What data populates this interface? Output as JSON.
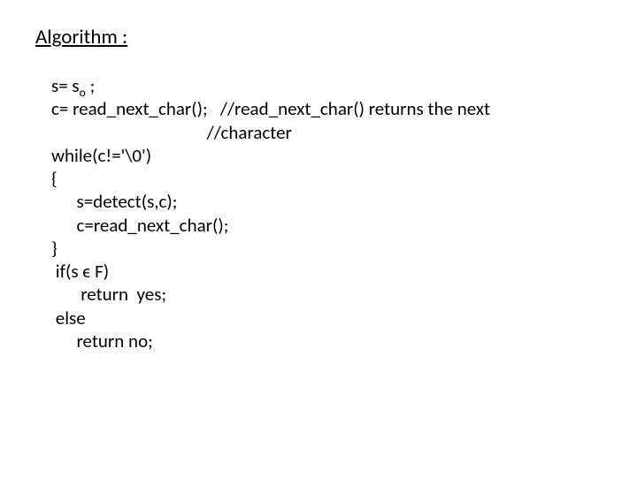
{
  "title": "Algorithm :",
  "code": {
    "l1a": "s= s",
    "l1sub": "o",
    "l1b": " ;",
    "l2": "c= read_next_char();   //read_next_char() returns the next",
    "l3": "                                     //character",
    "l4": "while(c!='\\0')",
    "l5": "{",
    "l6": "      s=detect(s,c);",
    "l7": "      c=read_next_char();",
    "l8": "}",
    "l9": " if(s ϵ F)",
    "l10": "       return  yes;",
    "l11": " else",
    "l12": "      return no;"
  }
}
